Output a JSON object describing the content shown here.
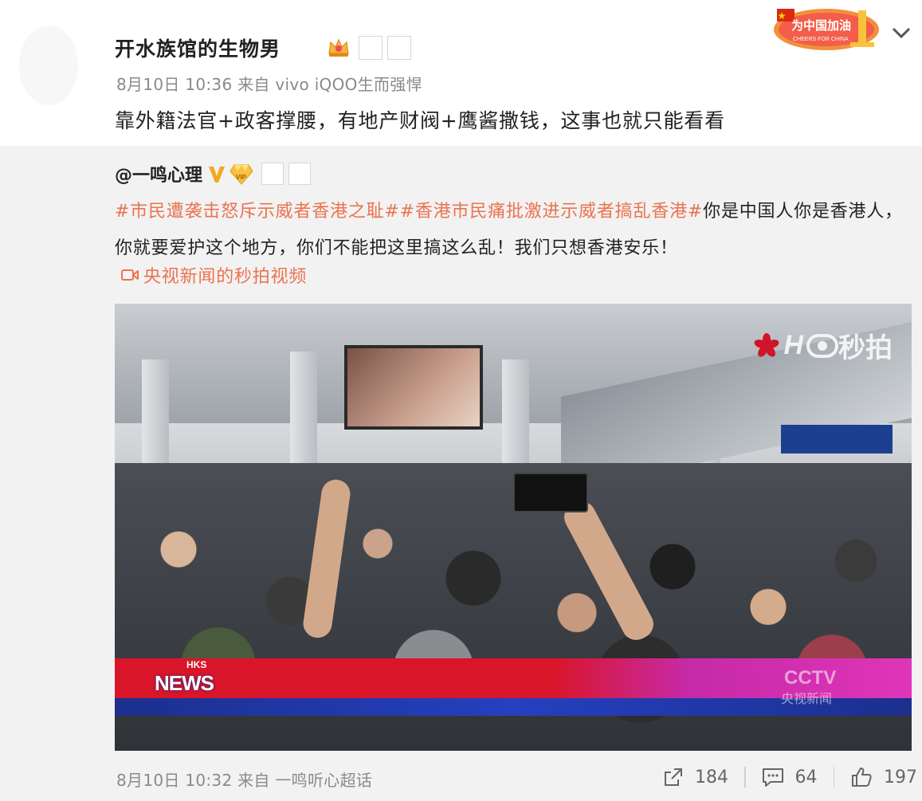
{
  "post": {
    "author": "开水族馆的生物男",
    "meta": "8月10日 10:36 来自 vivo iQOO生而强悍",
    "text": "靠外籍法官+政客撑腰，有地产财阀+鹰酱撒钱，这事也就只能看看",
    "badge": {
      "cn": "为中国加油",
      "en": "CHEERS FOR CHINA"
    }
  },
  "repost": {
    "author": "@一鸣心理",
    "vip_label": "VIP",
    "tags": [
      "#市民遭袭击怒斥示威者香港之耻#",
      "#香港市民痛批激进示威者搞乱香港#"
    ],
    "text": "你是中国人你是香港人，你就要爱护这个地方，你们不能把这里搞这么乱！我们只想香港安乐！",
    "video_link": "央视新闻的秒拍视频",
    "video": {
      "watermark": "秒拍",
      "watermark_prefix": "H",
      "news_label": "NEWS",
      "news_sub": "HKS",
      "cctv": "CCTV",
      "cctv_sub": "央视新闻"
    },
    "meta": "8月10日 10:32 来自 一鸣听心超话",
    "actions": {
      "forward": "184",
      "comment": "64",
      "like": "197"
    }
  },
  "colors": {
    "link": "#eb7350",
    "meta": "#8a8a8a",
    "repost_bg": "#f2f2f2"
  },
  "icons": [
    "crown-icon",
    "chevron-down-icon",
    "verified-icon",
    "vip-diamond-icon",
    "video-icon",
    "forward-icon",
    "comment-icon",
    "like-icon"
  ]
}
